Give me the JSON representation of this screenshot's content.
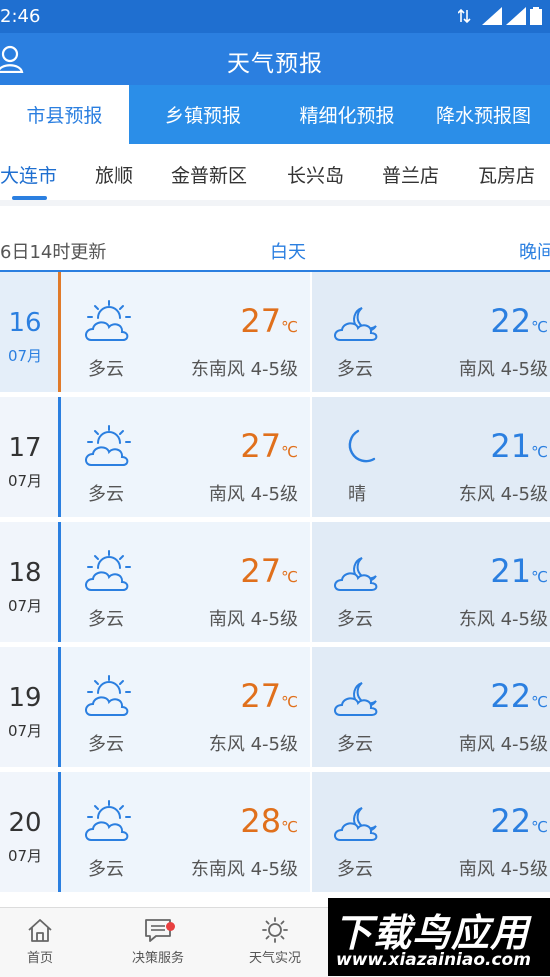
{
  "status_bar": {
    "time": "2:46"
  },
  "app_bar": {
    "title": "天气预报"
  },
  "tabs": [
    "市县预报",
    "乡镇预报",
    "精细化预报",
    "降水预报图"
  ],
  "districts": [
    "大连市",
    "旅顺",
    "金普新区",
    "长兴岛",
    "普兰店",
    "瓦房店"
  ],
  "subheader": {
    "updated": "6日14时更新",
    "day_label": "白天",
    "night_label": "晚间"
  },
  "temp_unit": "℃",
  "forecast": [
    {
      "day": "16",
      "month": "07月",
      "day_icon": "partly-cloudy-sun-icon",
      "day_condition": "多云",
      "day_temp": "27",
      "day_wind_dir": "东南风",
      "day_wind_level": "4-5级",
      "night_icon": "partly-cloudy-moon-icon",
      "night_condition": "多云",
      "night_temp": "22",
      "night_wind_dir": "南风",
      "night_wind_level": "4-5级"
    },
    {
      "day": "17",
      "month": "07月",
      "day_icon": "partly-cloudy-sun-icon",
      "day_condition": "多云",
      "day_temp": "27",
      "day_wind_dir": "南风",
      "day_wind_level": "4-5级",
      "night_icon": "moon-icon",
      "night_condition": "晴",
      "night_temp": "21",
      "night_wind_dir": "东风",
      "night_wind_level": "4-5级"
    },
    {
      "day": "18",
      "month": "07月",
      "day_icon": "partly-cloudy-sun-icon",
      "day_condition": "多云",
      "day_temp": "27",
      "day_wind_dir": "南风",
      "day_wind_level": "4-5级",
      "night_icon": "partly-cloudy-moon-icon",
      "night_condition": "多云",
      "night_temp": "21",
      "night_wind_dir": "东风",
      "night_wind_level": "4-5级"
    },
    {
      "day": "19",
      "month": "07月",
      "day_icon": "partly-cloudy-sun-icon",
      "day_condition": "多云",
      "day_temp": "27",
      "day_wind_dir": "东风",
      "day_wind_level": "4-5级",
      "night_icon": "partly-cloudy-moon-icon",
      "night_condition": "多云",
      "night_temp": "22",
      "night_wind_dir": "南风",
      "night_wind_level": "4-5级"
    },
    {
      "day": "20",
      "month": "07月",
      "day_icon": "partly-cloudy-sun-icon",
      "day_condition": "多云",
      "day_temp": "28",
      "day_wind_dir": "东南风",
      "day_wind_level": "4-5级",
      "night_icon": "partly-cloudy-moon-icon",
      "night_condition": "多云",
      "night_temp": "22",
      "night_wind_dir": "南风",
      "night_wind_level": "4-5级"
    }
  ],
  "bottom_nav": [
    {
      "label": "首页",
      "icon": "home-icon"
    },
    {
      "label": "决策服务",
      "icon": "message-icon"
    },
    {
      "label": "天气实况",
      "icon": "sun-icon"
    }
  ],
  "watermark": {
    "title": "下载鸟应用",
    "url": "www.xiazainiao.com"
  },
  "colors": {
    "primary": "#2b7fe0",
    "tab_bar": "#2b8ee8",
    "day_temp": "#e0701c",
    "night_temp": "#2b7fe0",
    "highlight_bar": "#e07a2a"
  }
}
